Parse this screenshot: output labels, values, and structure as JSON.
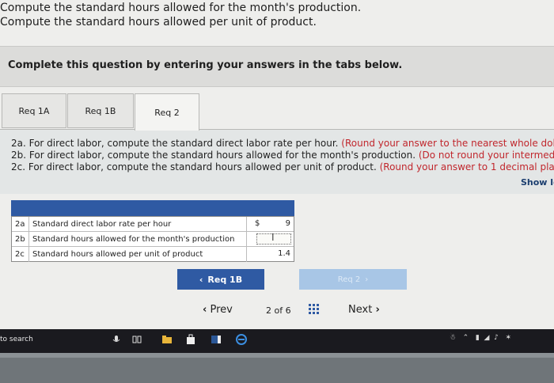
{
  "question": {
    "line1": "Compute the standard hours allowed for the month's production.",
    "line2": "Compute the standard hours allowed per unit of product."
  },
  "banner": "Complete this question by entering your answers in the tabs below.",
  "tabs": [
    {
      "label": "Req 1A",
      "active": false
    },
    {
      "label": "Req 1B",
      "active": false
    },
    {
      "label": "Req 2",
      "active": true
    }
  ],
  "instructions": {
    "a_text": "2a. For direct labor, compute the standard direct labor rate per hour.",
    "a_note": "(Round your answer to the nearest whole dollar.)",
    "b_text": "2b. For direct labor, compute the standard hours allowed for the month's production.",
    "b_note": "(Do not round your intermediate",
    "c_text": "2c. For direct labor, compute the standard hours allowed per unit of product.",
    "c_note": "(Round your answer to 1 decimal place.)",
    "show_me": "Show le"
  },
  "table": {
    "rows": [
      {
        "id": "2a",
        "label": "Standard direct labor rate per hour",
        "currency": "$",
        "value": "9"
      },
      {
        "id": "2b",
        "label": "Standard hours allowed for the month's production",
        "currency": "",
        "value": ""
      },
      {
        "id": "2c",
        "label": "Standard hours allowed per unit of product",
        "currency": "",
        "value": "1.4"
      }
    ]
  },
  "nav": {
    "prev_req": "Req 1B",
    "next_req": "Req 2"
  },
  "pagination": {
    "prev": "Prev",
    "current": "2",
    "of": "of",
    "total": "6",
    "next": "Next"
  },
  "taskbar": {
    "search": "to search"
  },
  "colors": {
    "accent": "#2f5aa3",
    "disabled_button": "#a8c6e6",
    "note_red": "#c1272d",
    "taskbar": "#1a1a1f"
  }
}
